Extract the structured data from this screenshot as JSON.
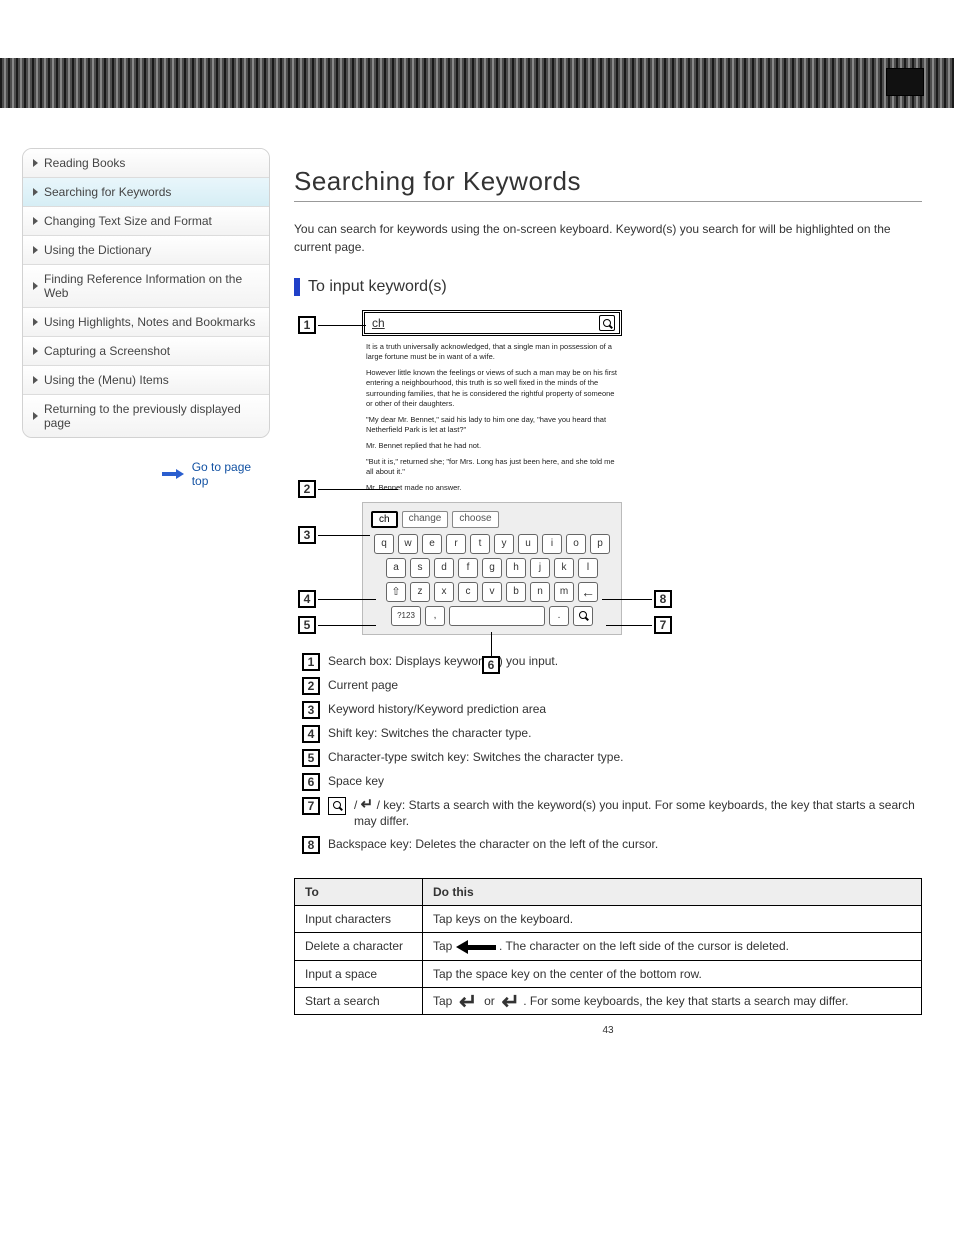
{
  "page_number": "43",
  "sidebar": {
    "items": [
      {
        "label": "Reading Books"
      },
      {
        "label": "Searching for Keywords"
      },
      {
        "label": "Changing Text Size and Format"
      },
      {
        "label": "Using the Dictionary"
      },
      {
        "label": "Finding Reference Information on the Web"
      },
      {
        "label": "Using Highlights, Notes and Bookmarks"
      },
      {
        "label": "Capturing a Screenshot"
      },
      {
        "label": "Using the (Menu) Items"
      },
      {
        "label": "Returning to the previously displayed page"
      }
    ],
    "active_index": 1,
    "goto": "Go to page top"
  },
  "heading": "Searching for Keywords",
  "lead": "You can search for keywords using the on-screen keyboard. Keyword(s) you search for will be highlighted on the current page.",
  "subheading": "To input keyword(s)",
  "screenshot": {
    "search_value": "ch",
    "paragraphs": [
      "It is a truth universally acknowledged, that a single man in possession of a large fortune must be in want of a wife.",
      "However little known the feelings or views of such a man may be on his first entering a neighbourhood, this truth is so well fixed in the minds of the surrounding families, that he is considered the rightful property of someone or other of their daughters.",
      "\"My dear Mr. Bennet,\" said his lady to him one day, \"have you heard that Netherfield Park is let at last?\"",
      "Mr. Bennet replied that he had not.",
      "\"But it is,\" returned she; \"for Mrs. Long has just been here, and she told me all about it.\"",
      "Mr. Bennet made no answer."
    ],
    "suggestions": [
      "ch",
      "change",
      "choose"
    ],
    "keys_r1": [
      "q",
      "w",
      "e",
      "r",
      "t",
      "y",
      "u",
      "i",
      "o",
      "p"
    ],
    "keys_r2": [
      "a",
      "s",
      "d",
      "f",
      "g",
      "h",
      "j",
      "k",
      "l"
    ],
    "keys_r3": [
      "z",
      "x",
      "c",
      "v",
      "b",
      "n",
      "m"
    ],
    "numkey": "?123",
    "comma": ",",
    "period": "."
  },
  "legend": [
    {
      "n": "1",
      "text": "Search box: Displays keyword(s) you input."
    },
    {
      "n": "2",
      "text": "Current page"
    },
    {
      "n": "3",
      "text": "Keyword history/Keyword prediction area"
    },
    {
      "n": "4",
      "text": "Shift key: Switches the character type."
    },
    {
      "n": "5",
      "text": "Character-type switch key: Switches the character type."
    },
    {
      "n": "6",
      "text": "Space key"
    },
    {
      "n": "7",
      "icon": "search",
      "enter": true,
      "text": "/       key: Starts a search with the keyword(s) you input.  For some keyboards, the key that starts a search may differ."
    },
    {
      "n": "8",
      "text": "Backspace key: Deletes the character on the left of the cursor."
    }
  ],
  "table": {
    "head": [
      "To",
      "Do this"
    ],
    "rows": [
      {
        "to": "Input characters",
        "do_plain": "Tap keys on the keyboard."
      },
      {
        "to": "Delete a character",
        "do_arrow": true,
        "do_text": "Tap       .  The character on the left side of the cursor is deleted."
      },
      {
        "to": "Input a space",
        "do_plain": "Tap the space key on the center of the bottom row."
      },
      {
        "to": "Start a search",
        "do_enter": true,
        "do_text": "Tap         or        .  For some keyboards, the key that starts a search may differ."
      }
    ]
  }
}
